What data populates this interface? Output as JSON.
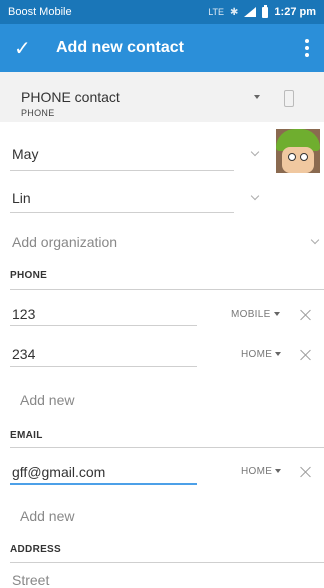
{
  "status_bar": {
    "carrier": "Boost Mobile",
    "network": "LTE",
    "time": "1:27 pm"
  },
  "app_bar": {
    "title": "Add new contact"
  },
  "account": {
    "name": "PHONE contact",
    "type": "PHONE"
  },
  "name_fields": {
    "first": "May",
    "last": "Lin"
  },
  "organization": {
    "placeholder": "Add organization"
  },
  "phone": {
    "section_label": "PHONE",
    "entries": [
      {
        "number": "123",
        "type": "MOBILE"
      },
      {
        "number": "234",
        "type": "HOME"
      }
    ],
    "add_label": "Add new"
  },
  "email": {
    "section_label": "EMAIL",
    "entries": [
      {
        "address": "gff@gmail.com",
        "type": "HOME"
      }
    ],
    "add_label": "Add new"
  },
  "address": {
    "section_label": "ADDRESS",
    "street_placeholder": "Street"
  }
}
